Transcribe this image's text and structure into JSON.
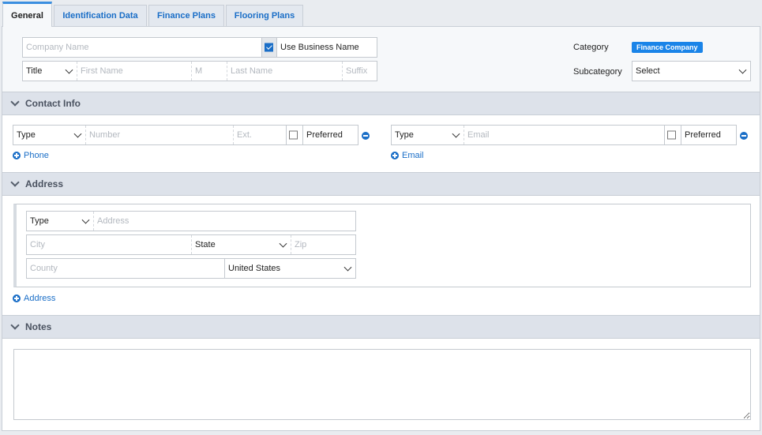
{
  "tabs": [
    {
      "label": "General",
      "active": true
    },
    {
      "label": "Identification Data",
      "active": false
    },
    {
      "label": "Finance Plans",
      "active": false
    },
    {
      "label": "Flooring Plans",
      "active": false
    }
  ],
  "general": {
    "company_name_placeholder": "Company Name",
    "use_business_name_label": "Use Business Name",
    "use_business_name_checked": true,
    "title_select": "Title",
    "first_name_placeholder": "First Name",
    "middle_placeholder": "M",
    "last_name_placeholder": "Last Name",
    "suffix_placeholder": "Suffix",
    "category_label": "Category",
    "category_badge": "Finance Company",
    "subcategory_label": "Subcategory",
    "subcategory_select": "Select"
  },
  "contact": {
    "section_title": "Contact Info",
    "phone": {
      "type_select": "Type",
      "number_placeholder": "Number",
      "ext_placeholder": "Ext.",
      "preferred_label": "Preferred",
      "add_label": "Phone"
    },
    "email": {
      "type_select": "Type",
      "email_placeholder": "Email",
      "preferred_label": "Preferred",
      "add_label": "Email"
    }
  },
  "address": {
    "section_title": "Address",
    "type_select": "Type",
    "address_placeholder": "Address",
    "city_placeholder": "City",
    "state_select": "State",
    "zip_placeholder": "Zip",
    "county_placeholder": "County",
    "country_select": "United States",
    "add_label": "Address"
  },
  "notes": {
    "section_title": "Notes"
  },
  "icons": {
    "checkbox": "checkbox-icon",
    "chevron": "chevron-down-icon",
    "remove": "minus-circle-icon",
    "add": "plus-circle-icon"
  },
  "colors": {
    "accent": "#1a6ec7",
    "badge": "#1a84e8",
    "section_bar": "#dde2ea"
  }
}
